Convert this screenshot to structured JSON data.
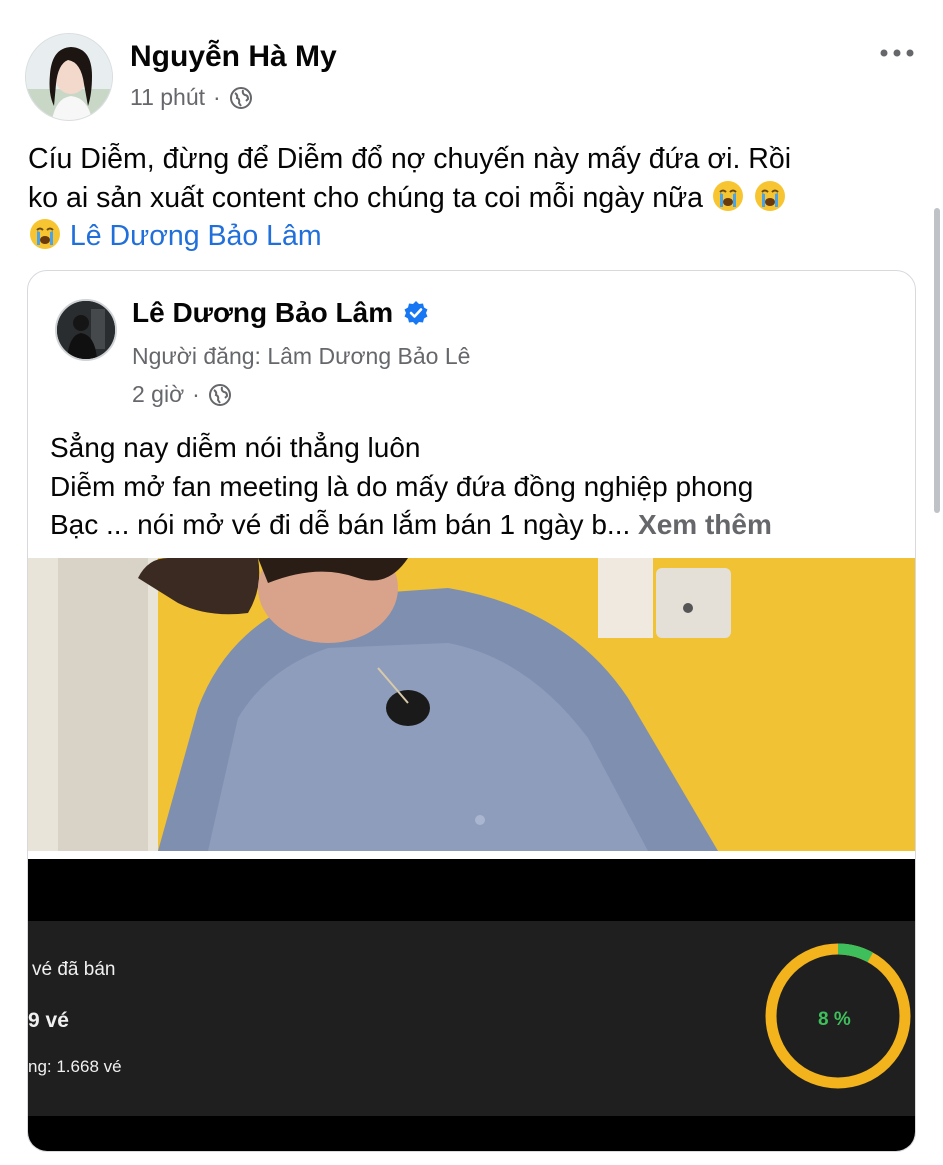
{
  "post": {
    "author": "Nguyễn Hà My",
    "time": "11 phút",
    "separator": "·",
    "text_line1": "Cíu Diễm, đừng để Diễm đổ nợ chuyến này mấy đứa ơi. Rồi",
    "text_line2": "ko ai sản xuất content cho chúng ta coi mỗi ngày nữa",
    "mention": "Lê Dương Bảo Lâm",
    "more_icon": "more-horizontal-icon",
    "colors": {
      "mention": "#216fdb",
      "meta": "#65676b"
    }
  },
  "shared": {
    "author": "Lê Dương Bảo Lâm",
    "poster": "Người đăng: Lâm Dương Bảo Lê",
    "time": "2 giờ",
    "separator": "·",
    "line1": "Sẳng nay diễm nói thẳng luôn",
    "line2": "Diễm mở fan meeting  là do mấy đứa đồng nghiệp phong",
    "line3": "Bạc ... nói mở vé đi dễ bán lắm bán 1 ngày b...",
    "see_more": "Xem thêm"
  },
  "ticket_panel": {
    "label1": "vé đã bán",
    "label2": "9 vé",
    "label3": "ng: 1.668 vé",
    "percent_label": "8 %",
    "percent": 0.08,
    "colors": {
      "ring": "#f2b31d",
      "progress": "#3fbf5c"
    }
  }
}
